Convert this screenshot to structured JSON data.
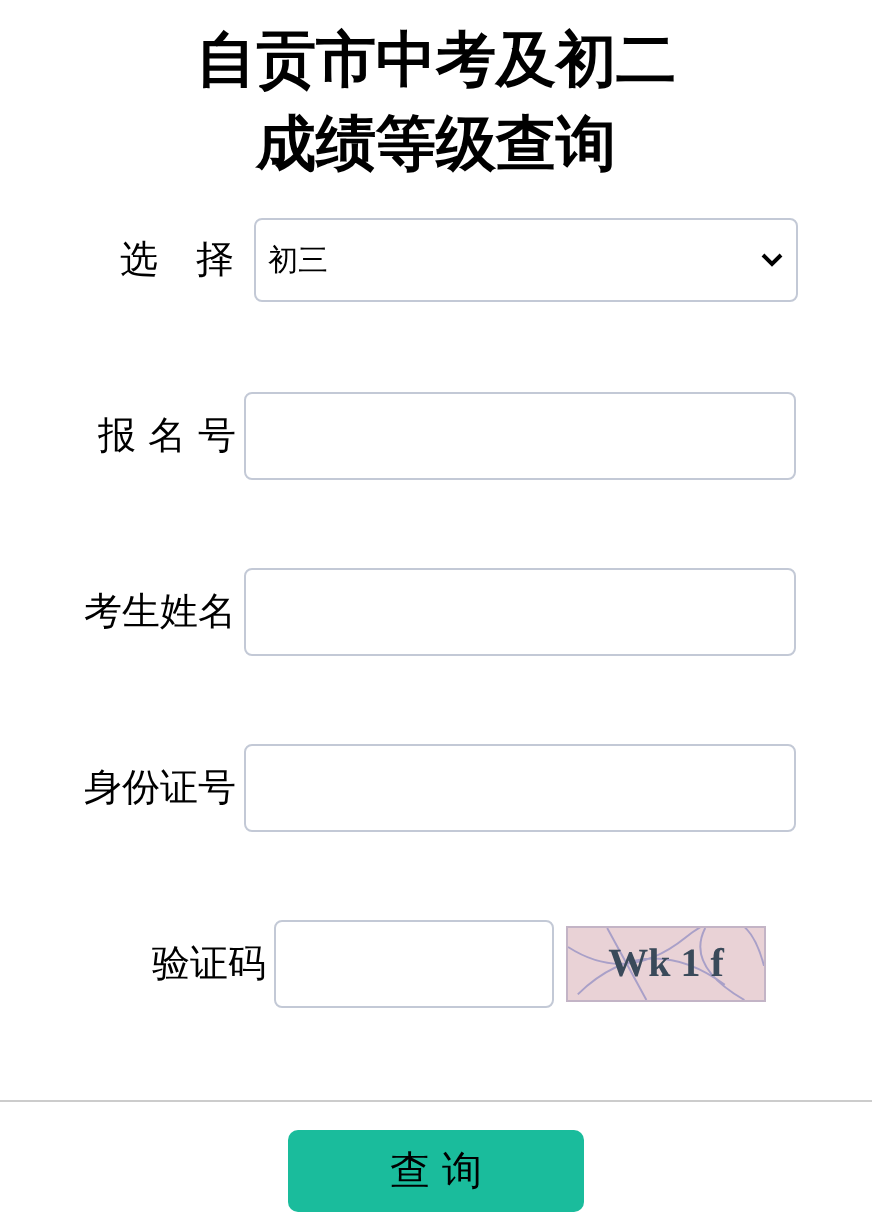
{
  "title": [
    "自贡市中考及初二",
    "成绩等级查询"
  ],
  "grade_select": {
    "label": "选　择",
    "value": "初三"
  },
  "fields": [
    {
      "label": "报 名 号"
    },
    {
      "label": "考生姓名"
    },
    {
      "label": "身份证号"
    }
  ],
  "captcha": {
    "label": "验证码",
    "image_text": "Wk 1 f"
  },
  "submit_button": "查 询"
}
